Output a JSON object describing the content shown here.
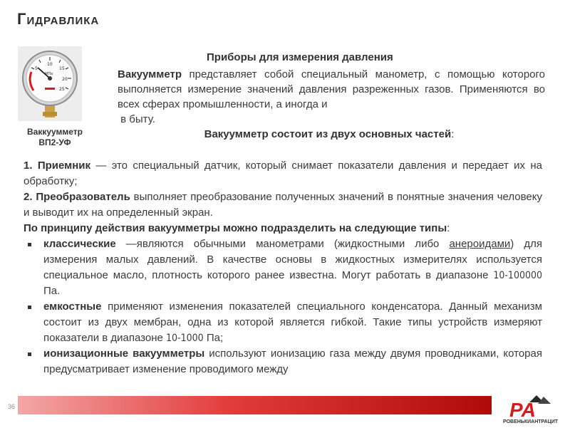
{
  "slide": {
    "title": "Гидравлика",
    "number": "36"
  },
  "image": {
    "caption_line1": "Ваккуумметр",
    "caption_line2": "ВП2-УФ",
    "dial_unit": "МПа"
  },
  "intro": {
    "heading": "Приборы для измерения давления",
    "term": "Вакуумметр",
    "text": " представляет собой специальный манометр, с помощью которого выполняется измерение значений давления разреженных газов. Применяются во всех сферах промышленности, а иногда и",
    "tail": "в быту."
  },
  "parts": {
    "heading": "Вакуумметр состоит из двух основных частей",
    "heading_suffix": ":",
    "item1_num": "1.",
    "item1_term": "Приемник",
    "item1_text": " — это специальный датчик, который снимает показатели давления и передает их на обработку;",
    "item2_num": "2.",
    "item2_term": "Преобразователь",
    "item2_text": " выполняет преобразование полученных значений в понятные значения человеку и выводит их на определенный экран."
  },
  "types": {
    "heading": "По принципу действия вакуумметры можно подразделить на следующие типы",
    "heading_suffix": ":",
    "items": [
      {
        "term": "классические",
        "text_before_link": " —являются обычными манометрами (жидкостными либо ",
        "link": "анероидами",
        "text_after_link": ") для измерения малых давлений. В качестве основы в жидкостных измерителях используется специальное масло, плотность которого ранее известна. Могут работать в диапазоне ",
        "range": "10-100000",
        "unit": " Па."
      },
      {
        "term": "емкостные",
        "text": " применяют изменения показателей специального конденсатора. Данный механизм состоит из двух мембран, одна из которой является гибкой. Такие типы устройств измеряют показатели в диапазоне ",
        "range": "10-1000",
        "unit": " Па;"
      },
      {
        "term": "ионизационные вакуумметры",
        "text": " используют ионизацию газа между двумя проводниками, которая предусматривает изменение проводимого между"
      }
    ]
  },
  "logo": {
    "mark": "PA",
    "name": "РОВЕНЬКИАНТРАЦИТ"
  },
  "colors": {
    "footer_bar_start": "#f3a7a7",
    "footer_bar_end": "#b00a0a",
    "logo_red": "#d41c1c"
  }
}
